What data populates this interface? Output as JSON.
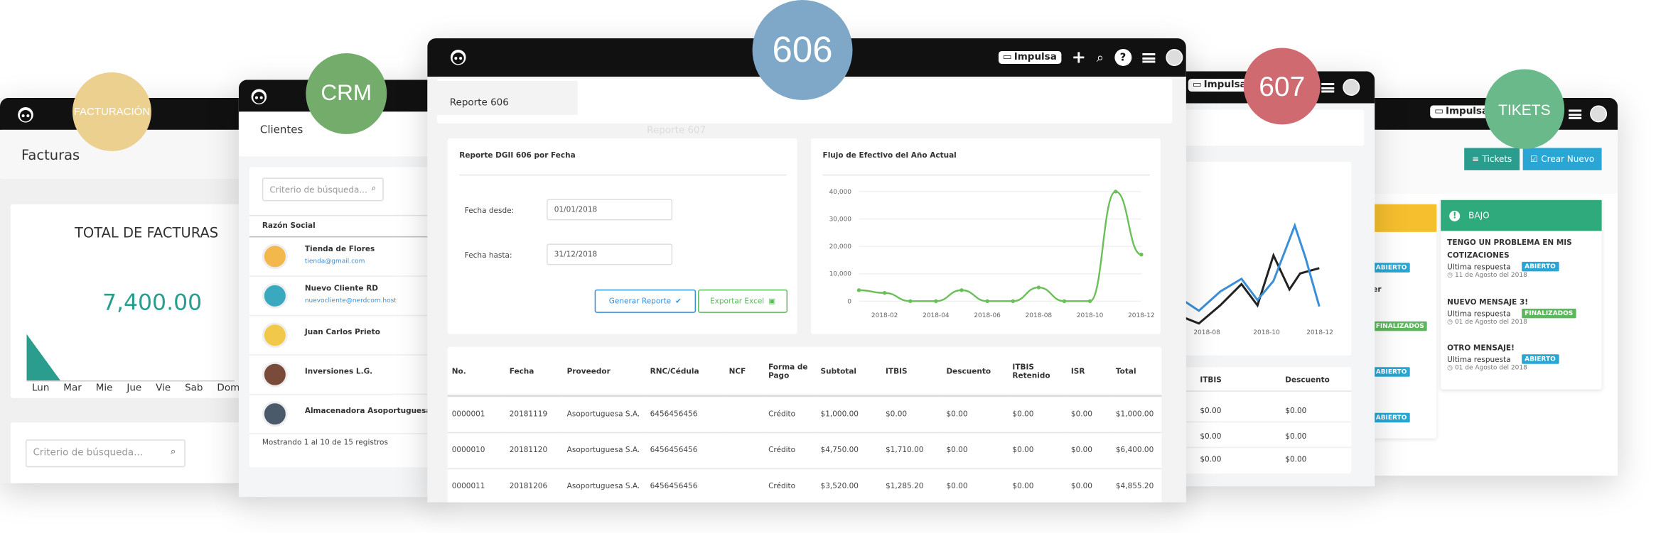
{
  "bubbles": {
    "facturacion": "FACTURACIÓN",
    "crm": "CRM",
    "r606": "606",
    "r607": "607",
    "tikets": "TIKETS"
  },
  "colors": {
    "facturacion": "#ecd08f",
    "crm": "#74ac6c",
    "r606": "#7ea7c8",
    "r607": "#cf6a70",
    "tikets": "#6ab98a",
    "teal": "#2a9d8f",
    "green_line": "#6abf59",
    "blue_line": "#3a8fd6"
  },
  "facturas": {
    "title": "Facturas",
    "total_label": "TOTAL DE FACTURAS",
    "total_value": "7,400.00",
    "days": [
      "Lun",
      "Mar",
      "Mie",
      "Jue",
      "Vie",
      "Sab",
      "Dom"
    ],
    "search_placeholder": "Criterio de búsqueda..."
  },
  "crm": {
    "title": "Clientes",
    "search_placeholder": "Criterio de búsqueda...",
    "col_header": "Razón Social",
    "clients": [
      {
        "name": "Tienda de Flores",
        "email": "tienda@gmail.com"
      },
      {
        "name": "Nuevo Cliente RD",
        "email": "nuevocliente@nerdcom.host"
      },
      {
        "name": "Juan Carlos Prieto",
        "email": ""
      },
      {
        "name": "Inversiones L.G.",
        "email": ""
      },
      {
        "name": "Almacenadora Asoportuguesa",
        "email": ""
      }
    ],
    "footer": "Mostrando 1 al 10 de 15 registros"
  },
  "r606": {
    "impulsa": "Impulsa",
    "breadcrumb": "Reporte 606",
    "ghost_tab": "Reporte 607",
    "form_title": "Reporte DGII 606 por Fecha",
    "from_label": "Fecha desde:",
    "from_value": "01/01/2018",
    "to_label": "Fecha hasta:",
    "to_value": "31/12/2018",
    "btn_generate": "Generar Reporte",
    "btn_export": "Exportar Excel",
    "chart_title": "Flujo de Efectivo del Año Actual",
    "columns": [
      "No.",
      "Fecha",
      "Proveedor",
      "RNC/Cédula",
      "NCF",
      "Forma de Pago",
      "Subtotal",
      "ITBIS",
      "Descuento",
      "ITBIS Retenido",
      "ISR",
      "Total"
    ],
    "rows": [
      [
        "0000001",
        "20181119",
        "Asoportuguesa S.A.",
        "6456456456",
        "",
        "Crédito",
        "$1,000.00",
        "$0.00",
        "$0.00",
        "$0.00",
        "$0.00",
        "$1,000.00"
      ],
      [
        "0000010",
        "20181120",
        "Asoportuguesa S.A.",
        "6456456456",
        "",
        "Crédito",
        "$4,750.00",
        "$1,710.00",
        "$0.00",
        "$0.00",
        "$0.00",
        "$6,400.00"
      ],
      [
        "0000011",
        "20181206",
        "Asoportuguesa S.A.",
        "6456456456",
        "",
        "Crédito",
        "$3,520.00",
        "$1,285.20",
        "$0.00",
        "$0.00",
        "$0.00",
        "$4,855.20"
      ]
    ]
  },
  "r607": {
    "impulsa": "Impulsa",
    "x_ticks": [
      "2018-08",
      "2018-10",
      "2018-12"
    ],
    "columns": [
      "ITBIS",
      "Descuento"
    ],
    "rows": [
      [
        "$0.00",
        "$0.00"
      ],
      [
        "$0.00",
        "$0.00"
      ],
      [
        "$0.00",
        "$0.00"
      ]
    ]
  },
  "tikets": {
    "impulsa": "Impulsa",
    "btn_tickets": "Tickets",
    "btn_new": "Crear Nuevo",
    "panel_title": "BAJO",
    "left_badges": [
      "ABIERTO",
      "FINALIZADOS",
      "ABIERTO",
      "ABIERTO"
    ],
    "left_partial": "er",
    "items": [
      {
        "title": "TENGO UN PROBLEMA EN MIS COTIZACIONES",
        "sub": "Ultima respuesta",
        "badge": "ABIERTO",
        "date": "11 de Agosto del 2018"
      },
      {
        "title": "NUEVO MENSAJE 3!",
        "sub": "Ultima respuesta",
        "badge": "FINALIZADOS",
        "date": "01 de Agosto del 2018"
      },
      {
        "title": "OTRO MENSAJE!",
        "sub": "Ultima respuesta",
        "badge": "ABIERTO",
        "date": "01 de Agosto del 2018"
      }
    ]
  },
  "chart_data": [
    {
      "type": "line",
      "title": "Flujo de Efectivo del Año Actual",
      "x": [
        "2018-01",
        "2018-02",
        "2018-03",
        "2018-04",
        "2018-05",
        "2018-06",
        "2018-07",
        "2018-08",
        "2018-09",
        "2018-10",
        "2018-11",
        "2018-12"
      ],
      "x_tick_labels": [
        "2018-02",
        "2018-04",
        "2018-06",
        "2018-08",
        "2018-10",
        "2018-12"
      ],
      "y_tick_labels": [
        "40,000",
        "30,000",
        "20,000",
        "10,000",
        "0"
      ],
      "ylim": [
        0,
        40000
      ],
      "series": [
        {
          "values": [
            4000,
            3000,
            0,
            0,
            4000,
            0,
            0,
            5000,
            0,
            0,
            40000,
            17000
          ]
        }
      ]
    },
    {
      "type": "area",
      "title": "",
      "categories": [
        "Lun",
        "Mar",
        "Mie",
        "Jue",
        "Vie",
        "Sab",
        "Dom"
      ],
      "values": [
        100,
        10,
        0,
        0,
        0,
        0,
        0
      ]
    }
  ]
}
